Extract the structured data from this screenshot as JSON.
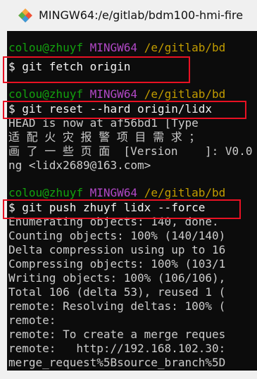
{
  "window": {
    "title": "MINGW64:/e/gitlab/bdm100-hmi-fire",
    "icon": "git-bash-icon",
    "accent": "#e81123"
  },
  "terminal": {
    "prompt": {
      "user_host": "colou@zhuyf",
      "env": "MINGW64",
      "path": "/e/gitlab/bd"
    },
    "commands": [
      "$ git fetch origin",
      "$ git reset --hard origin/lidx",
      "$ git push zhuyf lidx --force"
    ],
    "reset_output": [
      "HEAD is now at af56bd1 [Type",
      "适 配 火 灾 报 警 项 目 需 求 ；",
      "画 了 一 些 页 面  [Version    ]: V0.0",
      "ng <lidx2689@163.com>"
    ],
    "push_output": [
      "Enumerating objects: 140, done.",
      "Counting objects: 100% (140/140)",
      "Delta compression using up to 16",
      "Compressing objects: 100% (103/1",
      "Writing objects: 100% (106/106),",
      "Total 106 (delta 53), reused 1 (",
      "remote: Resolving deltas: 100% (",
      "remote:",
      "remote: To create a merge reques",
      "remote:   http://192.168.102.30:",
      "merge_request%5Bsource_branch%5D"
    ]
  }
}
